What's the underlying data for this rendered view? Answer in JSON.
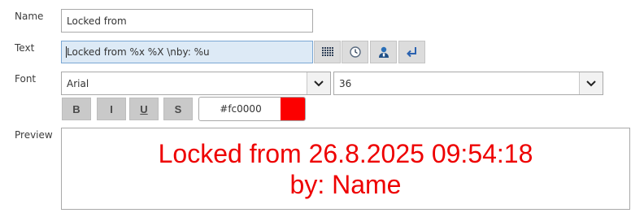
{
  "labels": {
    "name": "Name",
    "text": "Text",
    "font": "Font",
    "preview": "Preview"
  },
  "name_field": {
    "value": "Locked from"
  },
  "text_field": {
    "value": "Locked from %x %X \\nby: %u"
  },
  "icons": {
    "grid": "grid-icon",
    "clock": "clock-icon",
    "user": "user-icon",
    "newline": "return-arrow-icon"
  },
  "font": {
    "family": "Arial",
    "size": "36",
    "bold": "B",
    "italic": "I",
    "underline": "U",
    "strike": "S",
    "color_hex": "#fc0000"
  },
  "preview": {
    "line1": "Locked from 26.8.2025 09:54:18",
    "line2": "by: Name",
    "color": "#ee0000"
  }
}
